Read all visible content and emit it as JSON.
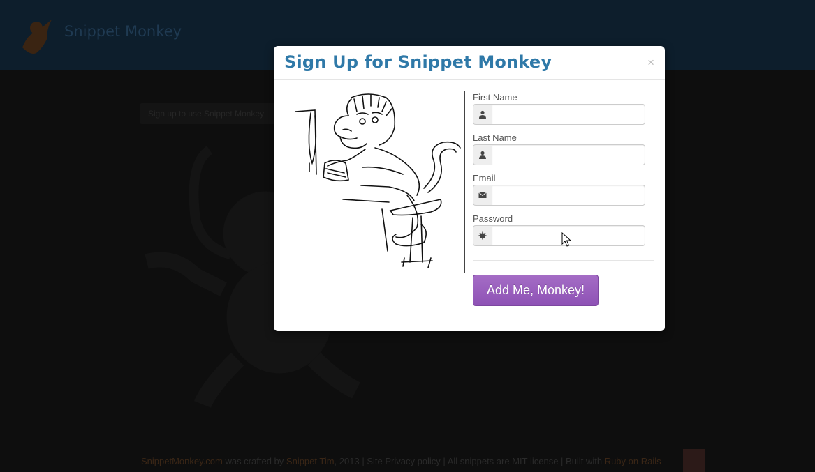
{
  "brand": {
    "name": "Snippet Monkey"
  },
  "background": {
    "well_text": "Sign up to use Snippet Monkey",
    "footer": {
      "site": "SnippetMonkey.com",
      "crafted": "was crafted by",
      "author": "Snippet Tim",
      "year": ", 2013",
      "sep1": " | ",
      "privacy": "Site Privacy policy",
      "sep2": " | ",
      "license_text": "All snippets are MIT license",
      "sep3": " | ",
      "built": "Built with",
      "rails": "Ruby on Rails"
    }
  },
  "modal": {
    "title": "Sign Up for Snippet Monkey",
    "close": "×",
    "fields": [
      {
        "label": "First Name",
        "icon": "user-icon",
        "value": "",
        "placeholder": ""
      },
      {
        "label": "Last Name",
        "icon": "user-icon",
        "value": "",
        "placeholder": ""
      },
      {
        "label": "Email",
        "icon": "envelope-icon",
        "value": "",
        "placeholder": ""
      },
      {
        "label": "Password",
        "icon": "asterisk-icon",
        "value": "",
        "placeholder": ""
      }
    ],
    "submit": "Add Me, Monkey!"
  },
  "colors": {
    "title": "#2f79a8",
    "button": "#9a5fc0",
    "navbar": "#0d1e2c"
  }
}
